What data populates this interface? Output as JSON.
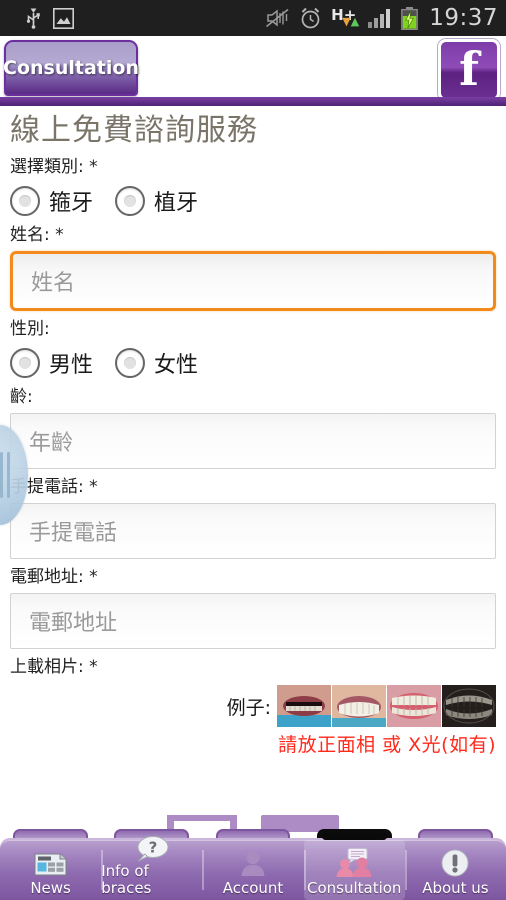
{
  "statusbar": {
    "icons_left": [
      "usb-icon",
      "screenshot-image-icon"
    ],
    "icons_right": [
      "mute-vibrate-off-icon",
      "alarm-clock-icon",
      "hplus-data-icon",
      "signal-bars-icon",
      "battery-charging-icon"
    ],
    "hplus_label": "H+",
    "arrow_down": "↓",
    "arrow_up": "↑",
    "time": "19:37"
  },
  "header": {
    "page_tab_label": "Consultation",
    "facebook_label": "f",
    "accent_purple": "#5b2a86"
  },
  "form": {
    "title": "線上免費諮詢服務",
    "category": {
      "label": "選擇類別: *",
      "options": [
        "箍牙",
        "植牙"
      ]
    },
    "name": {
      "label": "姓名: *",
      "value": "",
      "placeholder": "姓名",
      "focused": true,
      "focus_color": "#f28b1c"
    },
    "gender": {
      "label": "性別:",
      "options": [
        "男性",
        "女性"
      ]
    },
    "age": {
      "label": "齡:",
      "value": "",
      "placeholder": "年齡"
    },
    "phone": {
      "label": "手提電話: *",
      "value": "",
      "placeholder": "手提電話"
    },
    "email": {
      "label": "電郵地址: *",
      "value": "",
      "placeholder": "電郵地址"
    },
    "upload": {
      "label": "上載相片: *",
      "example_label": "例子:",
      "thumbs": [
        "teeth-photo-1",
        "teeth-photo-2",
        "teeth-photo-3",
        "dental-xray-photo"
      ],
      "note": "請放正面相 或 X光(如有)",
      "note_color": "#ff2a1c"
    }
  },
  "drag_handle": {
    "name": "edge-drag-handle"
  },
  "bottomnav": {
    "items": [
      {
        "label": "News",
        "icon": "newspaper-icon",
        "active": false
      },
      {
        "label": "Info of braces",
        "icon": "question-bubble-icon",
        "active": false
      },
      {
        "label": "Account",
        "icon": "person-icon",
        "active": false
      },
      {
        "label": "Consultation",
        "icon": "two-people-chat-icon",
        "active": true
      },
      {
        "label": "About us",
        "icon": "exclamation-circle-icon",
        "active": false
      }
    ]
  }
}
